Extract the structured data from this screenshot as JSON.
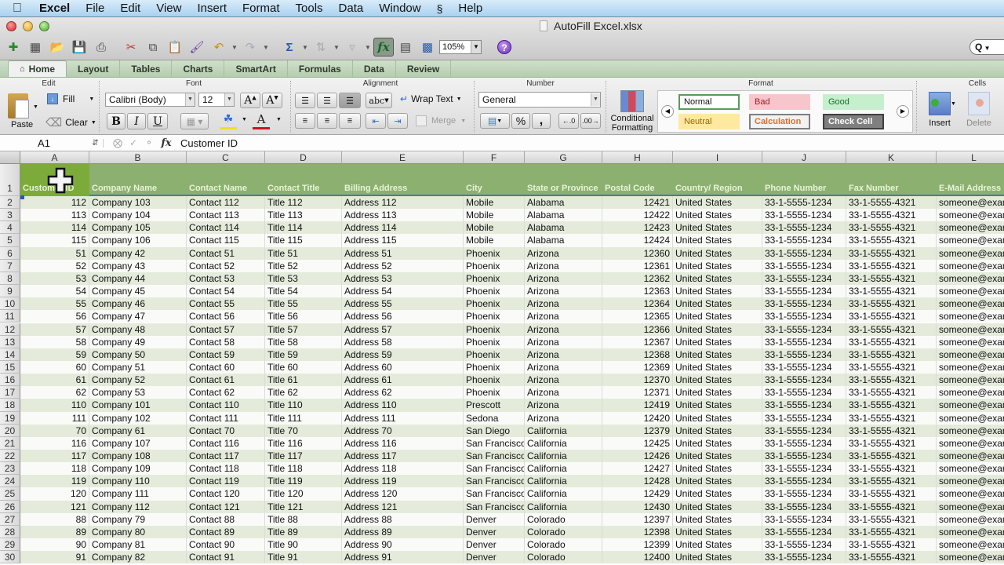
{
  "menubar": {
    "apple_icon": "apple-icon",
    "app": "Excel",
    "items": [
      "File",
      "Edit",
      "View",
      "Insert",
      "Format",
      "Tools",
      "Data",
      "Window",
      "Help"
    ],
    "script_icon": "script-menu-icon"
  },
  "window": {
    "title": "AutoFill Excel.xlsx",
    "zoom": "105%",
    "search_placeholder": "Q"
  },
  "ribbon": {
    "tabs": [
      "Home",
      "Layout",
      "Tables",
      "Charts",
      "SmartArt",
      "Formulas",
      "Data",
      "Review"
    ],
    "active_tab": "Home",
    "groups": {
      "edit": {
        "label": "Edit",
        "paste": "Paste",
        "fill": "Fill",
        "clear": "Clear"
      },
      "font": {
        "label": "Font",
        "font_name": "Calibri (Body)",
        "font_size": "12",
        "bold": "B",
        "italic": "I",
        "underline": "U"
      },
      "alignment": {
        "label": "Alignment",
        "wrap_text": "Wrap Text",
        "merge": "Merge",
        "orientation": "abc"
      },
      "number": {
        "label": "Number",
        "format": "General",
        "percent": "%",
        "comma": ","
      },
      "format": {
        "label": "Format",
        "conditional_formatting": [
          "Conditional",
          "Formatting"
        ],
        "styles": [
          {
            "name": "Normal",
            "bg": "#ffffff",
            "fg": "#111111",
            "border": "#5a9a5a"
          },
          {
            "name": "Bad",
            "bg": "#f7c6cc",
            "fg": "#9c1c28",
            "border": "#f7c6cc"
          },
          {
            "name": "Good",
            "bg": "#c6efce",
            "fg": "#1e6b2c",
            "border": "#c6efce"
          },
          {
            "name": "Neutral",
            "bg": "#ffe9a0",
            "fg": "#9c6500",
            "border": "#ffe9a0"
          },
          {
            "name": "Calculation",
            "bg": "#f2f2f2",
            "fg": "#e07020",
            "border": "#7f7f7f"
          },
          {
            "name": "Check Cell",
            "bg": "#7f7f7f",
            "fg": "#ffffff",
            "border": "#3f3f3f"
          }
        ]
      },
      "cells": {
        "label": "Cells",
        "insert": "Insert",
        "delete": "Delete"
      }
    }
  },
  "formula_bar": {
    "name_box": "A1",
    "fx": "fx",
    "value": "Customer ID"
  },
  "sheet": {
    "columns": [
      "A",
      "B",
      "C",
      "D",
      "E",
      "F",
      "G",
      "H",
      "I",
      "J",
      "K",
      "L"
    ],
    "headers": [
      "Customer ID",
      "Company Name",
      "Contact Name",
      "Contact Title",
      "Billing Address",
      "City",
      "State or Province",
      "Postal Code",
      "Country/ Region",
      "Phone Number",
      "Fax Number",
      "E-Mail Address"
    ],
    "header_display_A": "Custom",
    "header_display_A2": "D",
    "rows": [
      [
        2,
        "112",
        "Company 103",
        "Contact 112",
        "Title 112",
        "Address 112",
        "Mobile",
        "Alabama",
        "12421",
        "United States",
        "33-1-5555-1234",
        "33-1-5555-4321",
        "someone@exam"
      ],
      [
        3,
        "113",
        "Company 104",
        "Contact 113",
        "Title 113",
        "Address 113",
        "Mobile",
        "Alabama",
        "12422",
        "United States",
        "33-1-5555-1234",
        "33-1-5555-4321",
        "someone@exam"
      ],
      [
        4,
        "114",
        "Company 105",
        "Contact 114",
        "Title 114",
        "Address 114",
        "Mobile",
        "Alabama",
        "12423",
        "United States",
        "33-1-5555-1234",
        "33-1-5555-4321",
        "someone@exam"
      ],
      [
        5,
        "115",
        "Company 106",
        "Contact 115",
        "Title 115",
        "Address 115",
        "Mobile",
        "Alabama",
        "12424",
        "United States",
        "33-1-5555-1234",
        "33-1-5555-4321",
        "someone@exam"
      ],
      [
        6,
        "51",
        "Company 42",
        "Contact 51",
        "Title 51",
        "Address 51",
        "Phoenix",
        "Arizona",
        "12360",
        "United States",
        "33-1-5555-1234",
        "33-1-5555-4321",
        "someone@exam"
      ],
      [
        7,
        "52",
        "Company 43",
        "Contact 52",
        "Title 52",
        "Address 52",
        "Phoenix",
        "Arizona",
        "12361",
        "United States",
        "33-1-5555-1234",
        "33-1-5555-4321",
        "someone@exam"
      ],
      [
        8,
        "53",
        "Company 44",
        "Contact 53",
        "Title 53",
        "Address 53",
        "Phoenix",
        "Arizona",
        "12362",
        "United States",
        "33-1-5555-1234",
        "33-1-5555-4321",
        "someone@exam"
      ],
      [
        9,
        "54",
        "Company 45",
        "Contact 54",
        "Title 54",
        "Address 54",
        "Phoenix",
        "Arizona",
        "12363",
        "United States",
        "33-1-5555-1234",
        "33-1-5555-4321",
        "someone@exam"
      ],
      [
        10,
        "55",
        "Company 46",
        "Contact 55",
        "Title 55",
        "Address 55",
        "Phoenix",
        "Arizona",
        "12364",
        "United States",
        "33-1-5555-1234",
        "33-1-5555-4321",
        "someone@exam"
      ],
      [
        11,
        "56",
        "Company 47",
        "Contact 56",
        "Title 56",
        "Address 56",
        "Phoenix",
        "Arizona",
        "12365",
        "United States",
        "33-1-5555-1234",
        "33-1-5555-4321",
        "someone@exam"
      ],
      [
        12,
        "57",
        "Company 48",
        "Contact 57",
        "Title 57",
        "Address 57",
        "Phoenix",
        "Arizona",
        "12366",
        "United States",
        "33-1-5555-1234",
        "33-1-5555-4321",
        "someone@exam"
      ],
      [
        13,
        "58",
        "Company 49",
        "Contact 58",
        "Title 58",
        "Address 58",
        "Phoenix",
        "Arizona",
        "12367",
        "United States",
        "33-1-5555-1234",
        "33-1-5555-4321",
        "someone@exam"
      ],
      [
        14,
        "59",
        "Company 50",
        "Contact 59",
        "Title 59",
        "Address 59",
        "Phoenix",
        "Arizona",
        "12368",
        "United States",
        "33-1-5555-1234",
        "33-1-5555-4321",
        "someone@exam"
      ],
      [
        15,
        "60",
        "Company 51",
        "Contact 60",
        "Title 60",
        "Address 60",
        "Phoenix",
        "Arizona",
        "12369",
        "United States",
        "33-1-5555-1234",
        "33-1-5555-4321",
        "someone@exam"
      ],
      [
        16,
        "61",
        "Company 52",
        "Contact 61",
        "Title 61",
        "Address 61",
        "Phoenix",
        "Arizona",
        "12370",
        "United States",
        "33-1-5555-1234",
        "33-1-5555-4321",
        "someone@exam"
      ],
      [
        17,
        "62",
        "Company 53",
        "Contact 62",
        "Title 62",
        "Address 62",
        "Phoenix",
        "Arizona",
        "12371",
        "United States",
        "33-1-5555-1234",
        "33-1-5555-4321",
        "someone@exam"
      ],
      [
        18,
        "110",
        "Company 101",
        "Contact 110",
        "Title 110",
        "Address 110",
        "Prescott",
        "Arizona",
        "12419",
        "United States",
        "33-1-5555-1234",
        "33-1-5555-4321",
        "someone@exam"
      ],
      [
        19,
        "111",
        "Company 102",
        "Contact 111",
        "Title 111",
        "Address 111",
        "Sedona",
        "Arizona",
        "12420",
        "United States",
        "33-1-5555-1234",
        "33-1-5555-4321",
        "someone@exam"
      ],
      [
        20,
        "70",
        "Company 61",
        "Contact 70",
        "Title 70",
        "Address 70",
        "San Diego",
        "California",
        "12379",
        "United States",
        "33-1-5555-1234",
        "33-1-5555-4321",
        "someone@exam"
      ],
      [
        21,
        "116",
        "Company 107",
        "Contact 116",
        "Title 116",
        "Address 116",
        "San Francisco",
        "California",
        "12425",
        "United States",
        "33-1-5555-1234",
        "33-1-5555-4321",
        "someone@exam"
      ],
      [
        22,
        "117",
        "Company 108",
        "Contact 117",
        "Title 117",
        "Address 117",
        "San Francisco",
        "California",
        "12426",
        "United States",
        "33-1-5555-1234",
        "33-1-5555-4321",
        "someone@exam"
      ],
      [
        23,
        "118",
        "Company 109",
        "Contact 118",
        "Title 118",
        "Address 118",
        "San Francisco",
        "California",
        "12427",
        "United States",
        "33-1-5555-1234",
        "33-1-5555-4321",
        "someone@exam"
      ],
      [
        24,
        "119",
        "Company 110",
        "Contact 119",
        "Title 119",
        "Address 119",
        "San Francisco",
        "California",
        "12428",
        "United States",
        "33-1-5555-1234",
        "33-1-5555-4321",
        "someone@exam"
      ],
      [
        25,
        "120",
        "Company 111",
        "Contact 120",
        "Title 120",
        "Address 120",
        "San Francisco",
        "California",
        "12429",
        "United States",
        "33-1-5555-1234",
        "33-1-5555-4321",
        "someone@exam"
      ],
      [
        26,
        "121",
        "Company 112",
        "Contact 121",
        "Title 121",
        "Address 121",
        "San Francisco",
        "California",
        "12430",
        "United States",
        "33-1-5555-1234",
        "33-1-5555-4321",
        "someone@exam"
      ],
      [
        27,
        "88",
        "Company 79",
        "Contact 88",
        "Title 88",
        "Address 88",
        "Denver",
        "Colorado",
        "12397",
        "United States",
        "33-1-5555-1234",
        "33-1-5555-4321",
        "someone@exam"
      ],
      [
        28,
        "89",
        "Company 80",
        "Contact 89",
        "Title 89",
        "Address 89",
        "Denver",
        "Colorado",
        "12398",
        "United States",
        "33-1-5555-1234",
        "33-1-5555-4321",
        "someone@exam"
      ],
      [
        29,
        "90",
        "Company 81",
        "Contact 90",
        "Title 90",
        "Address 90",
        "Denver",
        "Colorado",
        "12399",
        "United States",
        "33-1-5555-1234",
        "33-1-5555-4321",
        "someone@exam"
      ],
      [
        30,
        "91",
        "Company 82",
        "Contact 91",
        "Title 91",
        "Address 91",
        "Denver",
        "Colorado",
        "12400",
        "United States",
        "33-1-5555-1234",
        "33-1-5555-4321",
        "someone@exam"
      ]
    ]
  },
  "colors": {
    "header_band": "#8cb070",
    "selected_cell": "#7dab3a",
    "row_stripe": "#e4ebdb",
    "ribbon_tab_bg": "#cfe0cb"
  }
}
